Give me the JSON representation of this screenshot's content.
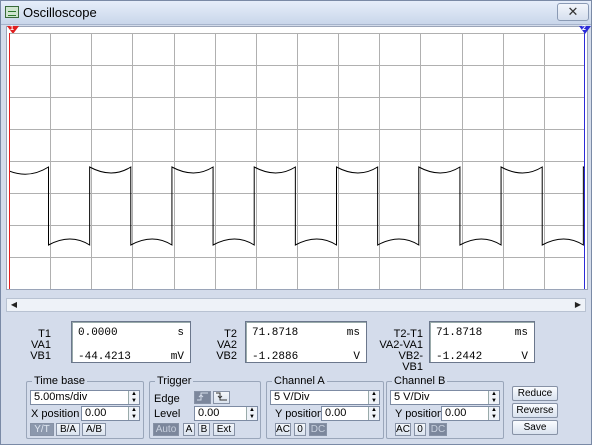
{
  "window": {
    "title": "Oscilloscope",
    "close_glyph": "✕"
  },
  "markers": {
    "a": "1",
    "b": "2"
  },
  "trace": {
    "color": "#000000",
    "grid_color": "#b0b0b0",
    "cursor_a_color": "#e02020",
    "cursor_b_color": "#2a2ad8"
  },
  "readouts": {
    "t1": {
      "labels": [
        "T1",
        "VA1",
        "VB1"
      ],
      "rows": [
        [
          "0.0000",
          "s"
        ],
        [
          "",
          ""
        ],
        [
          "-44.4213",
          "mV"
        ]
      ]
    },
    "t2": {
      "labels": [
        "T2",
        "VA2",
        "VB2"
      ],
      "rows": [
        [
          "71.8718",
          "ms"
        ],
        [
          "",
          ""
        ],
        [
          "-1.2886",
          "V"
        ]
      ]
    },
    "t21": {
      "labels": [
        "T2-T1",
        "VA2-VA1",
        "VB2-VB1"
      ],
      "rows": [
        [
          "71.8718",
          "ms"
        ],
        [
          "",
          ""
        ],
        [
          "-1.2442",
          "V"
        ]
      ]
    }
  },
  "timebase": {
    "title": "Time base",
    "scale": "5.00ms/div",
    "xpos_label": "X position",
    "xpos": "0.00",
    "buttons": [
      "Y/T",
      "B/A",
      "A/B"
    ]
  },
  "trigger": {
    "title": "Trigger",
    "edge_label": "Edge",
    "level_label": "Level",
    "level": "0.00",
    "buttons": [
      "Auto",
      "A",
      "B",
      "Ext"
    ]
  },
  "channel_a": {
    "title": "Channel A",
    "scale": "5  V/Div",
    "ypos_label": "Y position",
    "ypos": "0.00",
    "buttons": [
      "AC",
      "0",
      "DC"
    ]
  },
  "channel_b": {
    "title": "Channel B",
    "scale": "5  V/Div",
    "ypos_label": "Y position",
    "ypos": "0.00",
    "buttons": [
      "AC",
      "0",
      "DC"
    ]
  },
  "actions": {
    "reduce": "Reduce",
    "reverse": "Reverse",
    "save": "Save"
  }
}
